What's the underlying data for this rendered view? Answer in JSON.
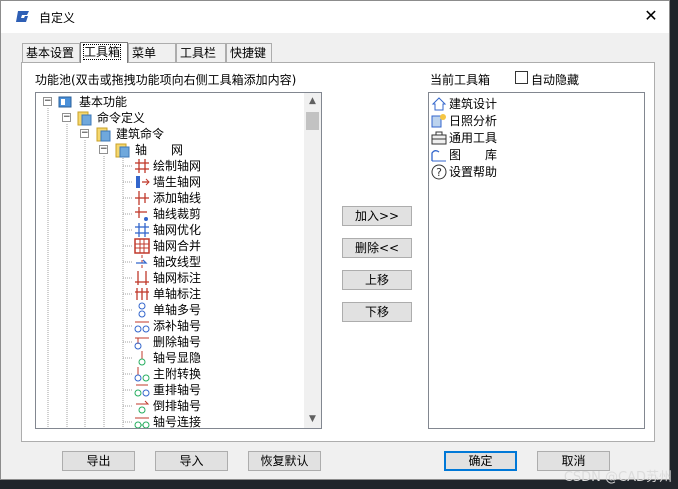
{
  "window": {
    "title": "自定义",
    "close_glyph": "✕"
  },
  "tabs": [
    {
      "label": "基本设置"
    },
    {
      "label": "工具箱"
    },
    {
      "label": "菜单"
    },
    {
      "label": "工具栏"
    },
    {
      "label": "快捷键"
    }
  ],
  "active_tab": "工具箱",
  "left_panel": {
    "label": "功能池(双击或拖拽功能项向右侧工具箱添加内容)",
    "tree": {
      "root": "基本功能",
      "level1": "命令定义",
      "level2": "建筑命令",
      "level3": "轴　　网",
      "items": [
        {
          "label": "绘制轴网",
          "icon": "grid-draw-icon"
        },
        {
          "label": "墙生轴网",
          "icon": "wall-to-grid-icon"
        },
        {
          "label": "添加轴线",
          "icon": "add-axis-icon"
        },
        {
          "label": "轴线裁剪",
          "icon": "trim-axis-icon"
        },
        {
          "label": "轴网优化",
          "icon": "optimize-grid-icon"
        },
        {
          "label": "轴网合并",
          "icon": "merge-grid-icon"
        },
        {
          "label": "轴改线型",
          "icon": "axis-linetype-icon"
        },
        {
          "label": "轴网标注",
          "icon": "grid-dimension-icon"
        },
        {
          "label": "单轴标注",
          "icon": "single-axis-dimension-icon"
        },
        {
          "label": "单轴多号",
          "icon": "multi-number-icon"
        },
        {
          "label": "添补轴号",
          "icon": "add-number-icon"
        },
        {
          "label": "删除轴号",
          "icon": "delete-number-icon"
        },
        {
          "label": "轴号显隐",
          "icon": "toggle-number-icon"
        },
        {
          "label": "主附转换",
          "icon": "main-sub-convert-icon"
        },
        {
          "label": "重排轴号",
          "icon": "renumber-icon"
        },
        {
          "label": "倒排轴号",
          "icon": "reverse-number-icon"
        },
        {
          "label": "轴号连接",
          "icon": "connect-number-icon"
        }
      ]
    }
  },
  "middle_buttons": {
    "add": "加入>>",
    "delete": "删除<<",
    "up": "上移",
    "down": "下移"
  },
  "right_panel": {
    "label": "当前工具箱",
    "auto_hide_label": "自动隐藏",
    "auto_hide_checked": false,
    "items": [
      {
        "label": "建筑设计",
        "icon": "house-icon"
      },
      {
        "label": "日照分析",
        "icon": "sunlight-icon"
      },
      {
        "label": "通用工具",
        "icon": "toolbox-icon"
      },
      {
        "label": "图　　库",
        "icon": "library-icon"
      },
      {
        "label": "设置帮助",
        "icon": "help-icon"
      }
    ]
  },
  "footer": {
    "export": "导出",
    "import": "导入",
    "restore": "恢复默认",
    "ok": "确定",
    "cancel": "取消"
  },
  "watermark": "CSDN @CAD苏州"
}
